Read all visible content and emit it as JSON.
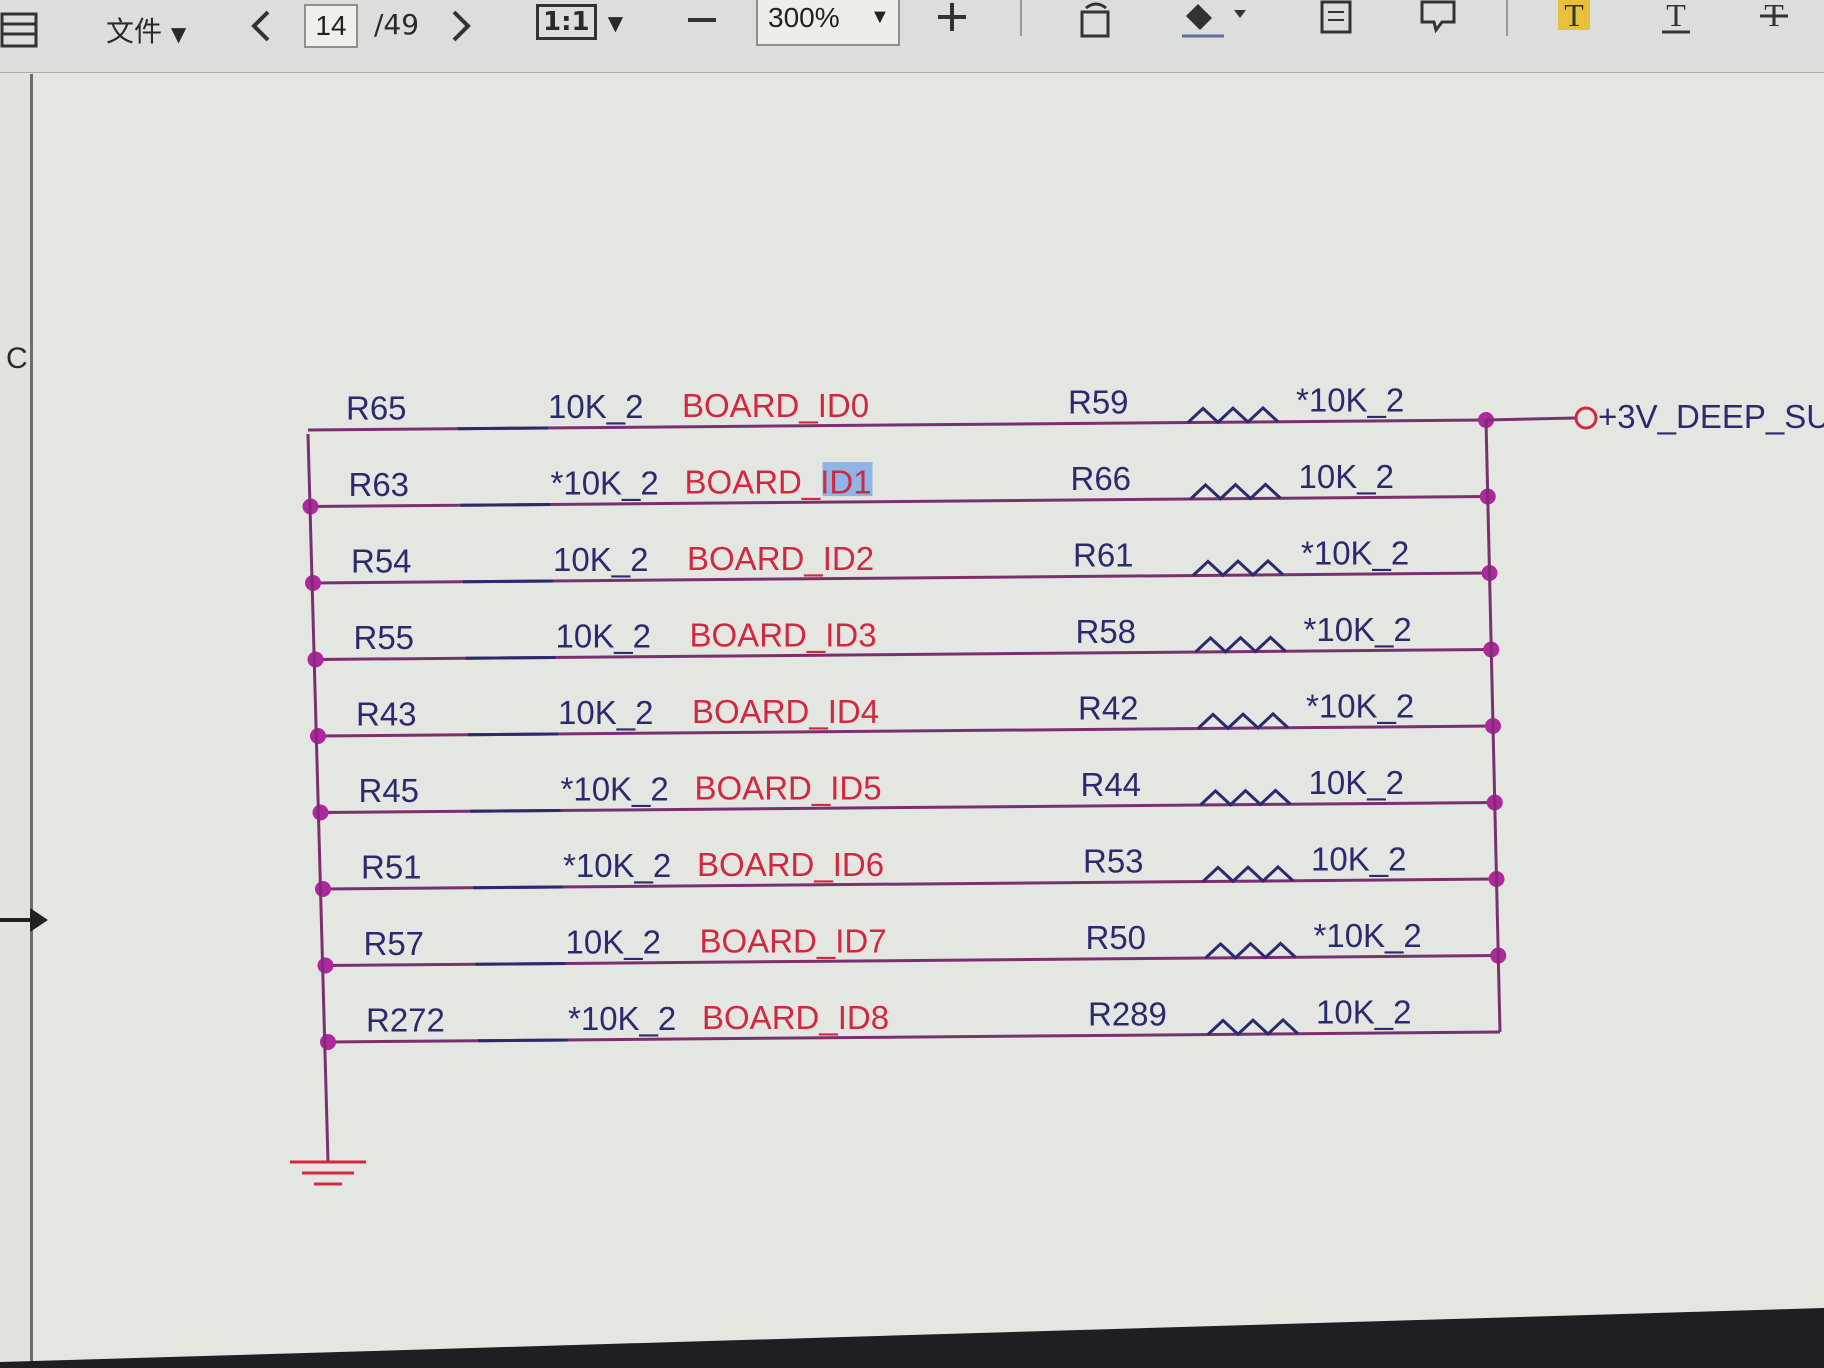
{
  "toolbar": {
    "file_menu_label": "文件",
    "current_page": "14",
    "total_pages": "/49",
    "fit_label": "1:1",
    "zoom_value": "300%"
  },
  "left_pane": {
    "marker": "C"
  },
  "schematic": {
    "rows": [
      {
        "ref_left": "R65",
        "val_left": "10K_2",
        "net": "BOARD_ID0",
        "ref_right": "R59",
        "val_right": "*10K_2"
      },
      {
        "ref_left": "R63",
        "val_left": "*10K_2",
        "net": "BOARD_ID1",
        "ref_right": "R66",
        "val_right": "10K_2"
      },
      {
        "ref_left": "R54",
        "val_left": "10K_2",
        "net": "BOARD_ID2",
        "ref_right": "R61",
        "val_right": "*10K_2"
      },
      {
        "ref_left": "R55",
        "val_left": "10K_2",
        "net": "BOARD_ID3",
        "ref_right": "R58",
        "val_right": "*10K_2"
      },
      {
        "ref_left": "R43",
        "val_left": "10K_2",
        "net": "BOARD_ID4",
        "ref_right": "R42",
        "val_right": "*10K_2"
      },
      {
        "ref_left": "R45",
        "val_left": "*10K_2",
        "net": "BOARD_ID5",
        "ref_right": "R44",
        "val_right": "10K_2"
      },
      {
        "ref_left": "R51",
        "val_left": "*10K_2",
        "net": "BOARD_ID6",
        "ref_right": "R53",
        "val_right": "10K_2"
      },
      {
        "ref_left": "R57",
        "val_left": "10K_2",
        "net": "BOARD_ID7",
        "ref_right": "R50",
        "val_right": "*10K_2"
      },
      {
        "ref_left": "R272",
        "val_left": "*10K_2",
        "net": "BOARD_ID8",
        "ref_right": "R289",
        "val_right": "10K_2"
      }
    ],
    "power_net": "+3V_DEEP_SU",
    "highlighted_text": "ID1"
  },
  "colors": {
    "net_red": "#d2283f",
    "wire_purple": "#7a2f6e",
    "junction_magenta": "#b0269e",
    "label_blue": "#2b2a6e",
    "highlight": "#8fb4e6"
  },
  "icons": [
    "sidebar-toggle-icon",
    "prev-page-icon",
    "next-page-icon",
    "zoom-out-icon",
    "zoom-in-icon",
    "rotate-icon",
    "fill-tool-icon",
    "note-icon",
    "comment-icon",
    "text-highlight-icon",
    "text-underline-icon",
    "text-strikeout-icon"
  ]
}
